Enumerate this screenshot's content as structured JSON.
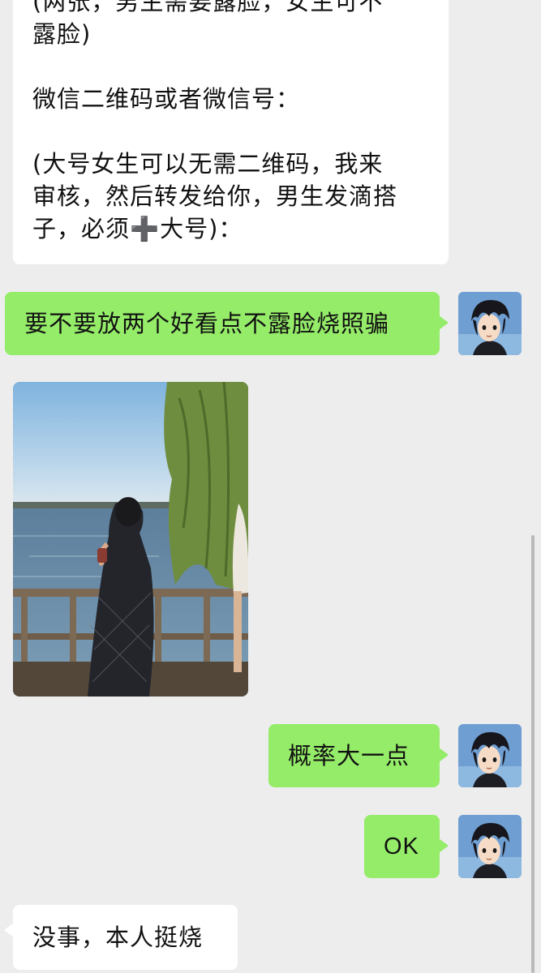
{
  "colors": {
    "background": "#ededed",
    "received_bubble": "#ffffff",
    "sent_bubble": "#95ec69",
    "scrollbar": "#b9b9b9"
  },
  "messages": [
    {
      "id": "m1",
      "direction": "received",
      "lines": [
        "(两张，男生需要露脸，女生可不",
        "露脸)",
        "",
        "微信二维码或者微信号：",
        "",
        "(大号女生可以无需二维码，我来",
        "审核，然后转发给你，男生发滴搭",
        "子，必须➕大号)："
      ]
    },
    {
      "id": "m2",
      "direction": "sent",
      "text": "要不要放两个好看点不露脸烧照骗",
      "avatar_icon": "anime-boy-avatar-icon"
    },
    {
      "id": "m3",
      "direction": "received",
      "type": "image",
      "image_icon": "lakeside-woman-photo"
    },
    {
      "id": "m4",
      "direction": "sent",
      "text": "概率大一点",
      "avatar_icon": "anime-boy-avatar-icon"
    },
    {
      "id": "m5",
      "direction": "sent",
      "text": "OK",
      "avatar_icon": "anime-boy-avatar-icon"
    },
    {
      "id": "m6",
      "direction": "received",
      "text": "没事，本人挺烧"
    }
  ]
}
